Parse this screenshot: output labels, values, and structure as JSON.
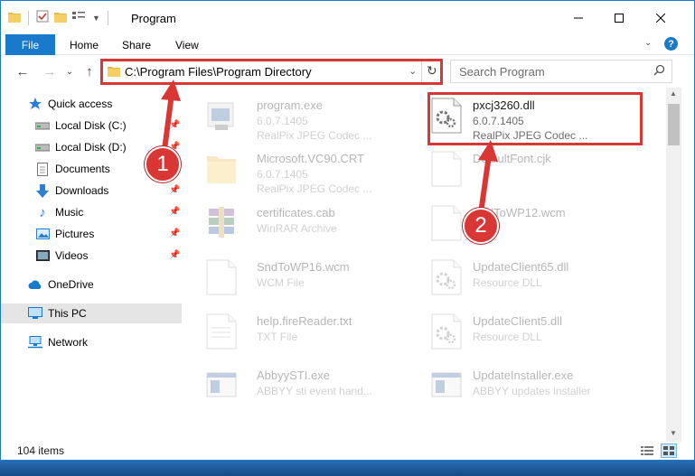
{
  "title": "Program",
  "ribbon": {
    "file": "File",
    "tabs": [
      "Home",
      "Share",
      "View"
    ]
  },
  "address": {
    "path": "C:\\Program Files\\Program Directory"
  },
  "search": {
    "placeholder": "Search Program"
  },
  "sidebar": {
    "items": [
      {
        "label": "Quick access",
        "icon": "star-icon"
      },
      {
        "label": "Local Disk (C:)",
        "icon": "drive-icon"
      },
      {
        "label": "Local Disk (D:)",
        "icon": "drive-icon"
      },
      {
        "label": "Documents",
        "icon": "documents-icon"
      },
      {
        "label": "Downloads",
        "icon": "download-icon"
      },
      {
        "label": "Music",
        "icon": "music-icon"
      },
      {
        "label": "Pictures",
        "icon": "pictures-icon"
      },
      {
        "label": "Videos",
        "icon": "videos-icon"
      },
      {
        "label": "OneDrive",
        "icon": "cloud-icon"
      },
      {
        "label": "This PC",
        "icon": "pc-icon"
      },
      {
        "label": "Network",
        "icon": "network-icon"
      }
    ]
  },
  "files": [
    {
      "name": "program.exe",
      "version": "6.0.7.1405",
      "desc": "RealPix JPEG Codec ..."
    },
    {
      "name": "pxcj3260.dll",
      "version": "6.0.7.1405",
      "desc": "RealPix JPEG Codec ..."
    },
    {
      "name": "Microsoft.VC90.CRT",
      "version": "6.0.7.1405",
      "desc": "RealPix JPEG Codec ..."
    },
    {
      "name": "DefaultFont.cjk",
      "version": "",
      "desc": ""
    },
    {
      "name": "certificates.cab",
      "version": "WinRAR Archive",
      "desc": ""
    },
    {
      "name": "SndToWP12.wcm",
      "version": "",
      "desc": ""
    },
    {
      "name": "SndToWP16.wcm",
      "version": "WCM File",
      "desc": ""
    },
    {
      "name": "UpdateClient65.dll",
      "version": "Resource DLL",
      "desc": ""
    },
    {
      "name": "help.fireReader.txt",
      "version": "TXT File",
      "desc": ""
    },
    {
      "name": "UpdateClient5.dll",
      "version": "Resource DLL",
      "desc": ""
    },
    {
      "name": "AbbyySTI.exe",
      "version": "ABBYY sti event hand...",
      "desc": ""
    },
    {
      "name": "UpdateInstaller.exe",
      "version": "ABBYY updates installer",
      "desc": ""
    }
  ],
  "status": {
    "count": "104 items"
  },
  "callouts": [
    "1",
    "2"
  ],
  "colors": {
    "accent": "#1979ca",
    "highlight": "#d93636"
  }
}
